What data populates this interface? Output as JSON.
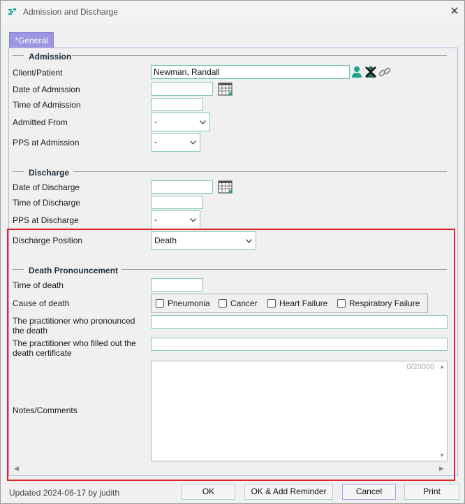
{
  "window": {
    "title": "Admission and Discharge"
  },
  "tabs": [
    {
      "label": "*General"
    }
  ],
  "admission": {
    "header": "Admission",
    "client_label": "Client/Patient",
    "client_value": "Newman, Randall",
    "date_label": "Date of Admission",
    "date_value": "",
    "time_label": "Time of Admission",
    "time_value": "",
    "from_label": "Admitted From",
    "from_value": "-",
    "pps_label": "PPS at Admission",
    "pps_value": "-"
  },
  "discharge": {
    "header": "Discharge",
    "date_label": "Date of Discharge",
    "date_value": "",
    "time_label": "Time of Discharge",
    "time_value": "",
    "pps_label": "PPS at Discharge",
    "pps_value": "-",
    "position_label": "Discharge Position",
    "position_value": "Death"
  },
  "death": {
    "header": "Death Pronouncement",
    "time_label": "Time of death",
    "time_value": "",
    "cause_label": "Cause of death",
    "causes": [
      {
        "label": "Pneumonia",
        "checked": false
      },
      {
        "label": "Cancer",
        "checked": false
      },
      {
        "label": "Heart Failure",
        "checked": false
      },
      {
        "label": "Respiratory Failure",
        "checked": false
      }
    ],
    "pronounced_label_1": "The practitioner who pronounced",
    "pronounced_label_2": "the death",
    "pronounced_value": "",
    "certificate_label_1": "The practitioner who filled out the",
    "certificate_label_2": "death certificate",
    "certificate_value": "",
    "notes_label": "Notes/Comments",
    "notes_value": "",
    "notes_counter": "0/20000"
  },
  "footer": {
    "status": "Updated 2024-06-17 by judith",
    "ok": "OK",
    "ok_reminder": "OK & Add Reminder",
    "cancel": "Cancel",
    "print": "Print"
  },
  "colors": {
    "tab": "#9c97e0",
    "field_border": "#7fc7b6",
    "highlight": "#e0202a",
    "accent": "#1aa58c"
  }
}
